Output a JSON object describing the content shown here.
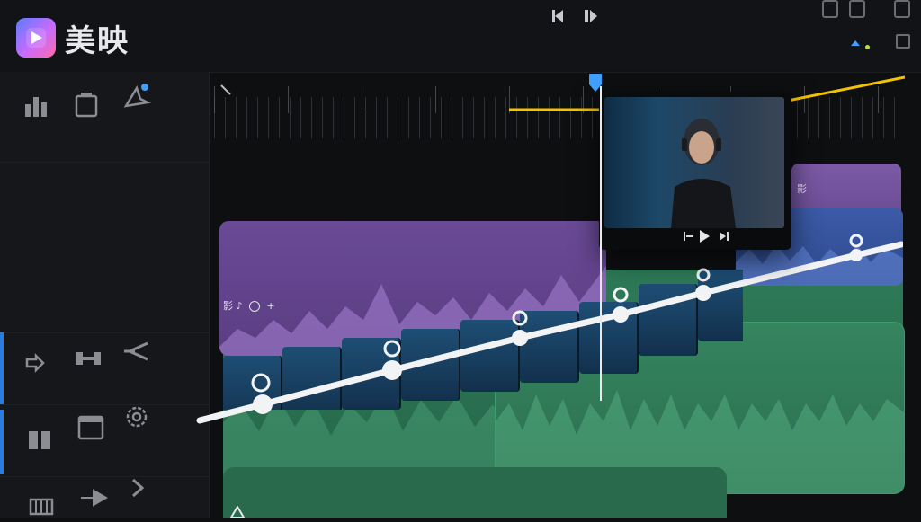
{
  "app": {
    "name": "美映"
  },
  "transport": {
    "prev_icon": "step-back-icon",
    "next_icon": "step-forward-icon"
  },
  "clips": {
    "purple_label": "影",
    "purple_right_label": "影",
    "audio_glyph": "♪"
  },
  "colors": {
    "accent": "#2b7be0",
    "playhead_marker": "#3fa0ff",
    "range": "#f2c300",
    "audio_purple": "#6a4a96",
    "audio_green": "#2e7a57",
    "video_blue": "#3b5aa8"
  }
}
